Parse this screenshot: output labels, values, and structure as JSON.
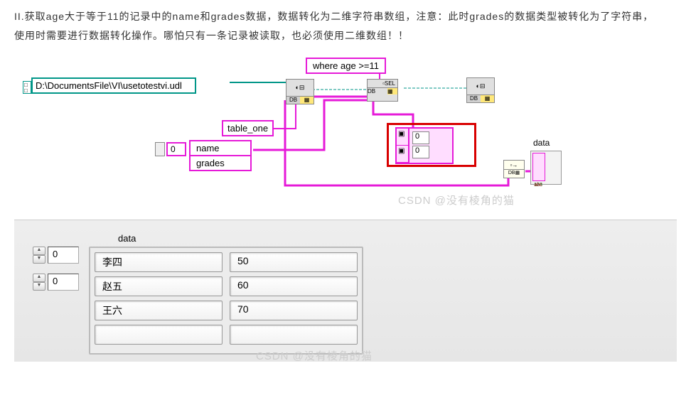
{
  "instruction": {
    "line1": "II.获取age大于等于11的记录中的name和grades数据，数据转化为二维字符串数组，注意：此时grades的数据类型被转化为了字符串，",
    "line2": "使用时需要进行数据转化操作。哪怕只有一条记录被读取，也必须使用二维数组！！"
  },
  "diagram": {
    "where": "where age >=11",
    "udl_path": "D:\\DocumentsFile\\VI\\usetotestvi.udl",
    "table": "table_one",
    "col_index": "0",
    "columns": [
      "name",
      "grades"
    ],
    "arr_idx": [
      "0",
      "0"
    ],
    "out_label": "data"
  },
  "panel": {
    "label": "data",
    "indices": [
      "0",
      "0"
    ],
    "rows": [
      [
        "李四",
        "50"
      ],
      [
        "赵五",
        "60"
      ],
      [
        "王六",
        "70"
      ]
    ]
  },
  "watermark": "CSDN @没有棱角的猫",
  "watermark2": "CSDN @没有棱角的猫",
  "chart_data": {
    "type": "table",
    "title": "data",
    "columns": [
      "name",
      "grades"
    ],
    "rows": [
      {
        "name": "李四",
        "grades": 50
      },
      {
        "name": "赵五",
        "grades": 60
      },
      {
        "name": "王六",
        "grades": 70
      }
    ],
    "query": {
      "table": "table_one",
      "where": "age >= 11",
      "select": [
        "name",
        "grades"
      ]
    }
  }
}
